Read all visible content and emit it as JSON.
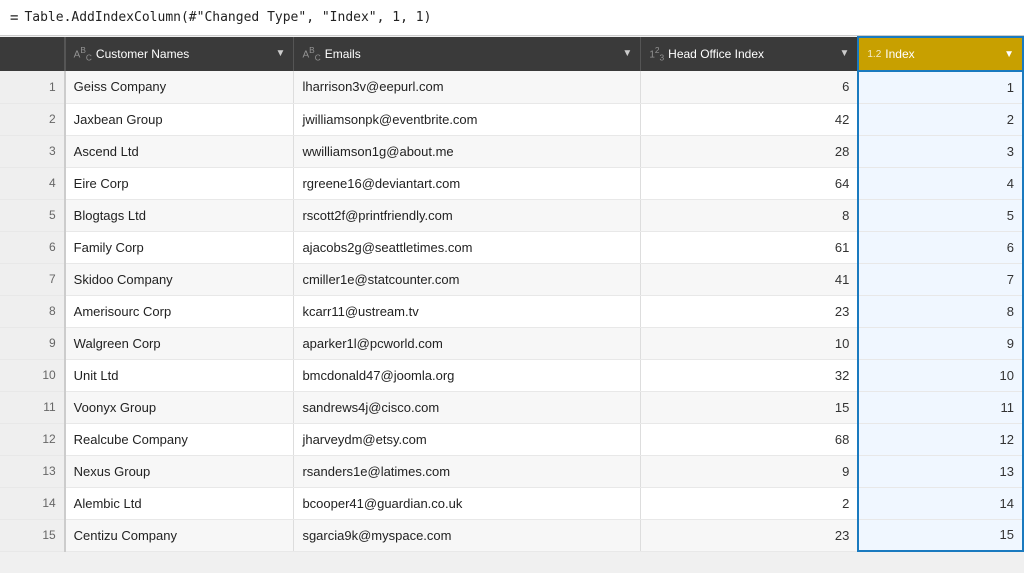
{
  "formula_bar": {
    "equals": "=",
    "formula": "Table.AddIndexColumn(#\"Changed Type\", \"Index\", 1, 1)"
  },
  "columns": [
    {
      "id": "row_num",
      "label": "",
      "type": "none"
    },
    {
      "id": "customer_names",
      "label": "Customer Names",
      "type": "ABC"
    },
    {
      "id": "emails",
      "label": "Emails",
      "type": "ABC"
    },
    {
      "id": "head_office_index",
      "label": "Head Office Index",
      "type": "123"
    },
    {
      "id": "index",
      "label": "Index",
      "type": "12"
    }
  ],
  "rows": [
    {
      "row": 1,
      "name": "Geiss Company",
      "email": "lharrison3v@eepurl.com",
      "hoi": 6,
      "idx": 1
    },
    {
      "row": 2,
      "name": "Jaxbean Group",
      "email": "jwilliamsonpk@eventbrite.com",
      "hoi": 42,
      "idx": 2
    },
    {
      "row": 3,
      "name": "Ascend Ltd",
      "email": "wwilliamson1g@about.me",
      "hoi": 28,
      "idx": 3
    },
    {
      "row": 4,
      "name": "Eire Corp",
      "email": "rgreene16@deviantart.com",
      "hoi": 64,
      "idx": 4
    },
    {
      "row": 5,
      "name": "Blogtags Ltd",
      "email": "rscott2f@printfriendly.com",
      "hoi": 8,
      "idx": 5
    },
    {
      "row": 6,
      "name": "Family Corp",
      "email": "ajacobs2g@seattletimes.com",
      "hoi": 61,
      "idx": 6
    },
    {
      "row": 7,
      "name": "Skidoo Company",
      "email": "cmiller1e@statcounter.com",
      "hoi": 41,
      "idx": 7
    },
    {
      "row": 8,
      "name": "Amerisourc Corp",
      "email": "kcarr11@ustream.tv",
      "hoi": 23,
      "idx": 8
    },
    {
      "row": 9,
      "name": "Walgreen Corp",
      "email": "aparker1l@pcworld.com",
      "hoi": 10,
      "idx": 9
    },
    {
      "row": 10,
      "name": "Unit Ltd",
      "email": "bmcdonald47@joomla.org",
      "hoi": 32,
      "idx": 10
    },
    {
      "row": 11,
      "name": "Voonyx Group",
      "email": "sandrews4j@cisco.com",
      "hoi": 15,
      "idx": 11
    },
    {
      "row": 12,
      "name": "Realcube Company",
      "email": "jharveydm@etsy.com",
      "hoi": 68,
      "idx": 12
    },
    {
      "row": 13,
      "name": "Nexus Group",
      "email": "rsanders1e@latimes.com",
      "hoi": 9,
      "idx": 13
    },
    {
      "row": 14,
      "name": "Alembic Ltd",
      "email": "bcooper41@guardian.co.uk",
      "hoi": 2,
      "idx": 14
    },
    {
      "row": 15,
      "name": "Centizu Company",
      "email": "sgarcia9k@myspace.com",
      "hoi": 23,
      "idx": 15
    }
  ]
}
